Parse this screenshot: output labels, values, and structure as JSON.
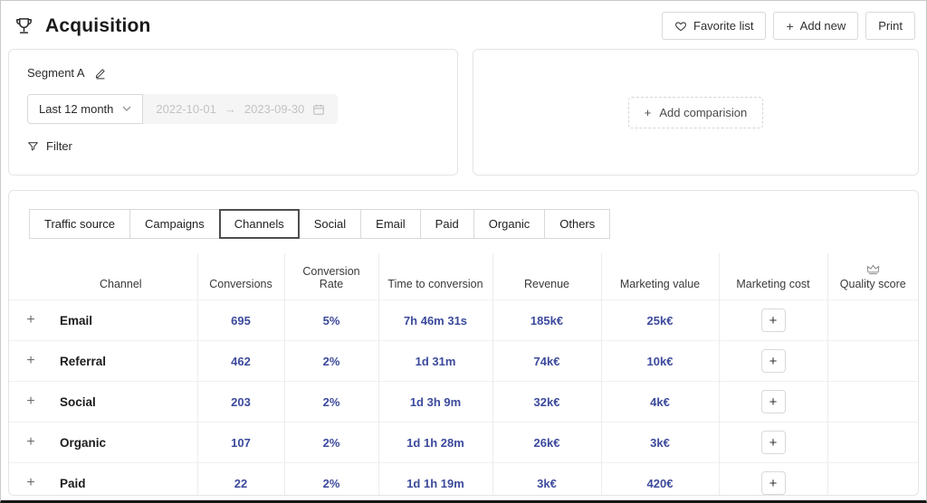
{
  "header": {
    "title": "Acquisition",
    "favorite_button": "Favorite list",
    "add_new_button": "Add new",
    "print_button": "Print"
  },
  "segment": {
    "name": "Segment A",
    "period": "Last 12 month",
    "date_start": "2022-10-01",
    "range_arrow": "→",
    "date_end": "2023-09-30",
    "filter_label": "Filter"
  },
  "comparison": {
    "add_button": "Add comparision"
  },
  "tabs": [
    {
      "label": "Traffic source"
    },
    {
      "label": "Campaigns"
    },
    {
      "label": "Channels"
    },
    {
      "label": "Social"
    },
    {
      "label": "Email"
    },
    {
      "label": "Paid"
    },
    {
      "label": "Organic"
    },
    {
      "label": "Others"
    }
  ],
  "active_tab": "Channels",
  "table": {
    "columns": {
      "channel": "Channel",
      "conversions": "Conversions",
      "rate": "Conversion Rate",
      "time": "Time to conversion",
      "revenue": "Revenue",
      "value": "Marketing value",
      "cost": "Marketing cost",
      "quality": "Quality score"
    },
    "rows": [
      {
        "channel": "Email",
        "conversions": "695",
        "rate": "5%",
        "time": "7h 46m 31s",
        "revenue": "185k€",
        "value": "25k€"
      },
      {
        "channel": "Referral",
        "conversions": "462",
        "rate": "2%",
        "time": "1d 31m",
        "revenue": "74k€",
        "value": "10k€"
      },
      {
        "channel": "Social",
        "conversions": "203",
        "rate": "2%",
        "time": "1d 3h 9m",
        "revenue": "32k€",
        "value": "4k€"
      },
      {
        "channel": "Organic",
        "conversions": "107",
        "rate": "2%",
        "time": "1d 1h 28m",
        "revenue": "26k€",
        "value": "3k€"
      },
      {
        "channel": "Paid",
        "conversions": "22",
        "rate": "2%",
        "time": "1d 1h 19m",
        "revenue": "3k€",
        "value": "420€"
      }
    ]
  },
  "icons": {
    "title": "trophy-icon",
    "favorite": "heart-icon",
    "add": "plus-icon",
    "period": "chevron-down-icon",
    "dates": "calendar-icon",
    "filter": "funnel-icon",
    "edit": "pencil-icon",
    "quality": "crown-icon"
  },
  "colors": {
    "value_accent": "#3c4a9c",
    "panel_border": "#e4e4e4",
    "active_tab_border": "#4d4d4d"
  }
}
